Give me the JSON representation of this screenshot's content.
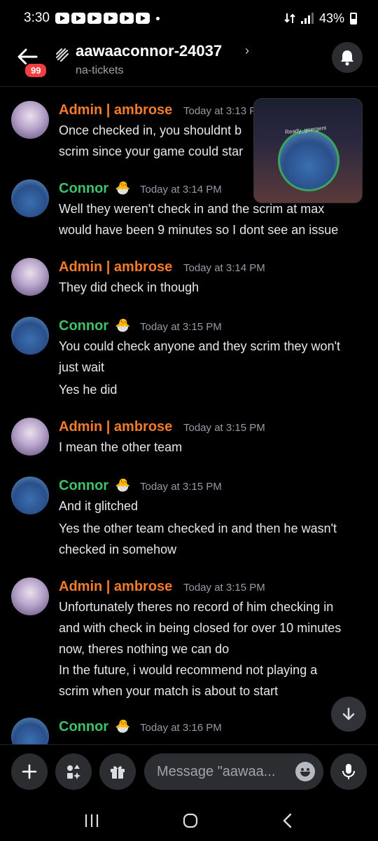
{
  "status_bar": {
    "time": "3:30",
    "battery": "43%"
  },
  "header": {
    "unread_badge": "99",
    "title": "aawaaconnor-24037",
    "chevron": "›",
    "subtitle": "na-tickets"
  },
  "messages": [
    {
      "author": "Admin | ambrose",
      "timestamp": "Today at 3:13 PM",
      "lines": [
        "Once checked in, you shouldnt b",
        "scrim since your game could star"
      ]
    },
    {
      "author": "Connor",
      "timestamp": "Today at 3:14 PM",
      "lines": [
        "Well they weren't check in and the scrim at max",
        "would have been 9 minutes so I dont see an issue"
      ]
    },
    {
      "author": "Admin | ambrose",
      "timestamp": "Today at 3:14 PM",
      "lines": [
        "They did check in though"
      ]
    },
    {
      "author": "Connor",
      "timestamp": "Today at 3:15 PM",
      "lines": [
        "You could check anyone and they scrim they won't",
        "just wait",
        "Yes he did"
      ]
    },
    {
      "author": "Admin | ambrose",
      "timestamp": "Today at 3:15 PM",
      "lines": [
        "I mean the other team"
      ]
    },
    {
      "author": "Connor",
      "timestamp": "Today at 3:15 PM",
      "lines": [
        "And it glitched",
        "Yes the other team checked in and then he wasn't",
        "checked in somehow"
      ]
    },
    {
      "author": "Admin | ambrose",
      "timestamp": "Today at 3:15 PM",
      "lines": [
        "Unfortunately theres no record of him checking in",
        "and with check in being closed for over 10 minutes",
        "now, theres nothing we can do",
        "In the future, i would recommend not playing a",
        "scrim when your match is about to start"
      ]
    },
    {
      "author": "Connor",
      "timestamp": "Today at 3:16 PM",
      "lines": []
    }
  ],
  "pip": {
    "label": "Ready_goergent"
  },
  "composer": {
    "placeholder": "Message \"aawaa..."
  },
  "colors": {
    "admin_name": "#f47b2a",
    "connor_name": "#3cc26b",
    "badge": "#f23f42",
    "background": "#000000"
  },
  "icons": [
    "back-arrow-icon",
    "thread-icon",
    "bell-icon",
    "chick-emoji-icon",
    "arrow-down-icon",
    "plus-icon",
    "apps-icon",
    "gift-icon",
    "emoji-icon",
    "microphone-icon",
    "recent-apps-icon",
    "home-icon",
    "back-nav-icon"
  ]
}
